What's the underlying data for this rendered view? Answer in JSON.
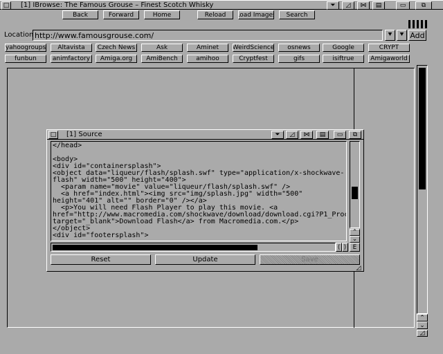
{
  "window": {
    "title": "[1] IBrowse: The Famous Grouse – Finest Scotch Whisky"
  },
  "toolbar": {
    "back": "Back",
    "forward": "Forward",
    "home": "Home",
    "reload": "Reload",
    "load_images": "Load Images",
    "search": "Search"
  },
  "location": {
    "label": "Location:",
    "url": "http://www.famousgrouse.com/",
    "add": "Add"
  },
  "hotlists": {
    "row1": [
      "yahoogroups",
      "Altavista",
      "Czech News",
      "Ask",
      "Aminet",
      "WeirdScience",
      "osnews",
      "Google",
      "CRYPT"
    ],
    "row2": [
      "funbun",
      "animfactory",
      "Amiga.org",
      "AmiBench",
      "amihoo",
      "Cryptfest",
      "gifs",
      "isiftrue",
      "Amigaworld"
    ]
  },
  "source": {
    "title": "[1] Source",
    "lines": [
      "</head>",
      "",
      "<body>",
      "<div id=\"containersplash\">",
      "<object data=\"liqueur/flash/splash.swf\" type=\"application/x-shockwave-",
      "flash\" width=\"500\" height=\"400\">",
      "  <param name=\"movie\" value=\"liqueur/flash/splash.swf\" />",
      "  <a href=\"index.html\"><img src=\"img/splash.jpg\" width=\"500\"",
      "height=\"401\" alt=\"\" border=\"0\" /></a>",
      "  <p>You will need Flash Player to play this movie. <a",
      "href=\"http://www.macromedia.com/shockwave/download/download.cgi?P1_Proc",
      "target=\"_blank\">Download Flash</a> from Macromedia.com.</p>",
      "</object>",
      "<div id=\"footersplash\">"
    ],
    "reset": "Reset",
    "update": "Update",
    "save": "Save"
  }
}
